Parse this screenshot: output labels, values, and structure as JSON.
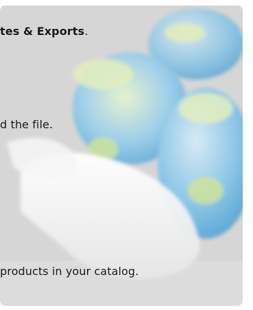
{
  "instructions": {
    "line1_bold": "tes & Exports",
    "line1_tail": ".",
    "line2": "d the file.",
    "line3": "products in your catalog."
  },
  "illustration": {
    "icon": "globe-stack-icon",
    "colors": {
      "background": "#d4d4d4",
      "globe_blue": "#6fb6e0",
      "globe_green": "#c9df8a",
      "base": "#f2f2f2"
    }
  }
}
